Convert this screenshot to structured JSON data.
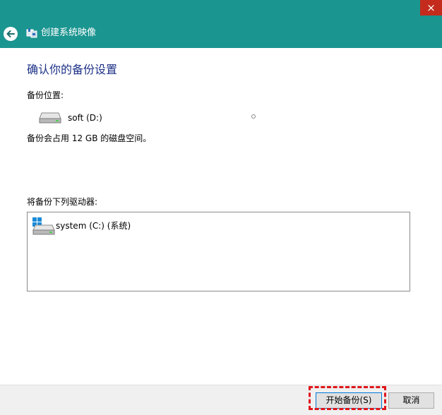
{
  "window": {
    "title": "创建系统映像",
    "close_glyph": "×",
    "back_icon": "back-arrow-icon"
  },
  "content": {
    "heading": "确认你的备份设置",
    "backup_location_label": "备份位置:",
    "backup_drive": "soft (D:)",
    "space_note": "备份会占用 12 GB 的磁盘空间。",
    "drives_label": "将备份下列驱动器:",
    "drives": [
      {
        "label": "system (C:) (系统)",
        "icon": "windows-drive-icon"
      }
    ]
  },
  "buttons": {
    "start_backup": "开始备份(S)",
    "cancel": "取消"
  },
  "colors": {
    "titlebar": "#1b9590",
    "heading": "#1e3287",
    "close": "#c42b1c",
    "highlight": "#e0161b"
  }
}
